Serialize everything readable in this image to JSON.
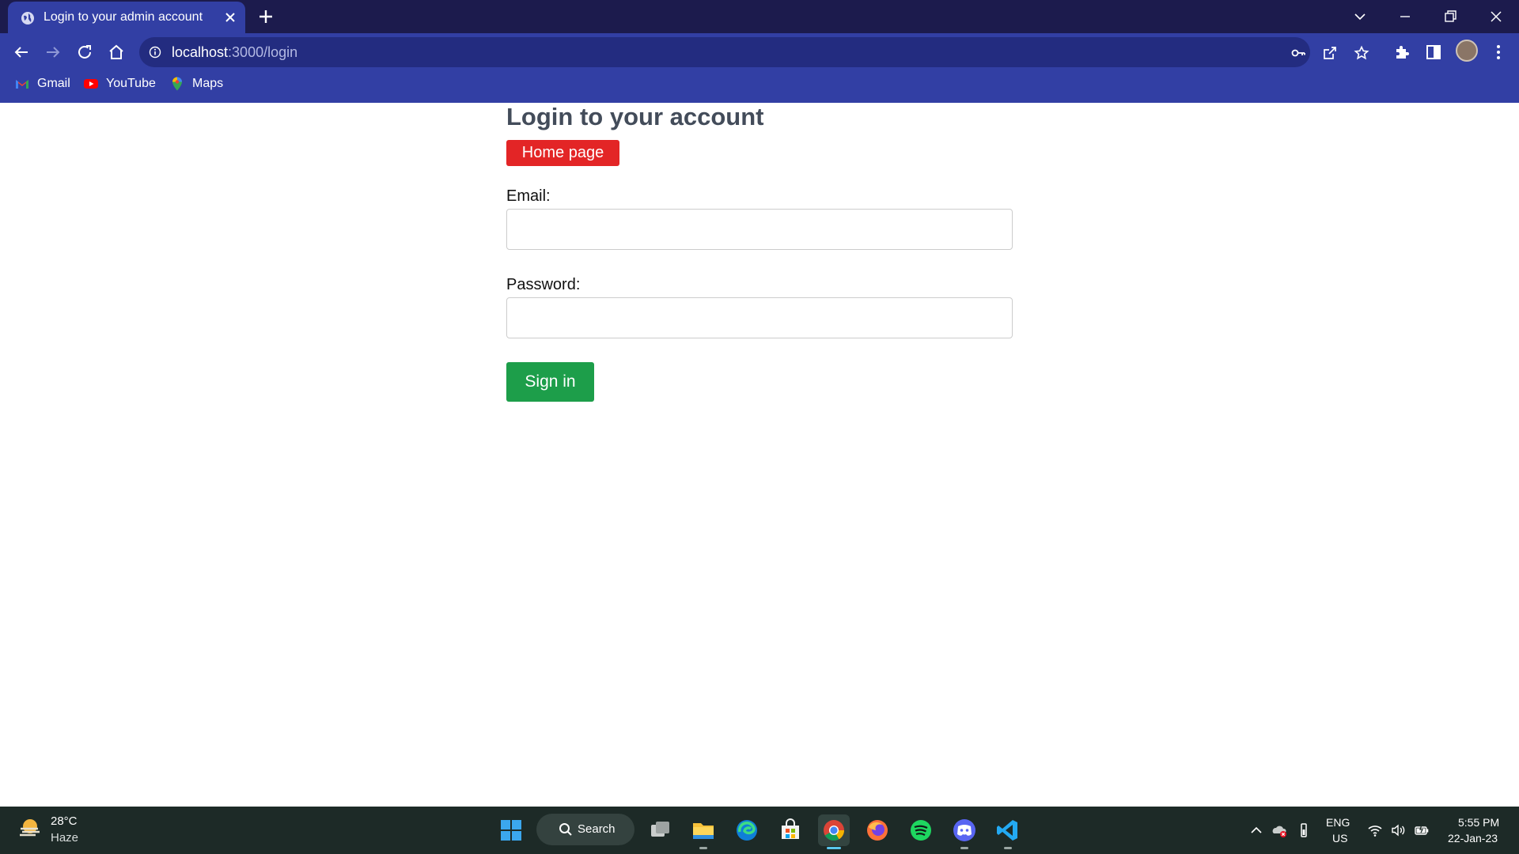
{
  "browser": {
    "tab_title": "Login to your admin account",
    "url_host": "localhost",
    "url_rest": ":3000/login",
    "bookmarks": [
      {
        "label": "Gmail",
        "icon": "gmail-icon"
      },
      {
        "label": "YouTube",
        "icon": "youtube-icon"
      },
      {
        "label": "Maps",
        "icon": "maps-icon"
      }
    ]
  },
  "page": {
    "heading": "Login to your account",
    "home_button": "Home page",
    "email_label": "Email:",
    "email_value": "",
    "password_label": "Password:",
    "password_value": "",
    "signin_button": "Sign in"
  },
  "taskbar": {
    "weather_temp": "28°C",
    "weather_desc": "Haze",
    "search_label": "Search",
    "lang_top": "ENG",
    "lang_bottom": "US",
    "time": "5:55 PM",
    "date": "22-Jan-23"
  },
  "colors": {
    "tabbar": "#1c1b4d",
    "toolbar": "#323fa4",
    "home_button": "#e32526",
    "signin_button": "#1d9e4a",
    "heading": "#434c5a",
    "taskbar": "#1d2a27"
  }
}
